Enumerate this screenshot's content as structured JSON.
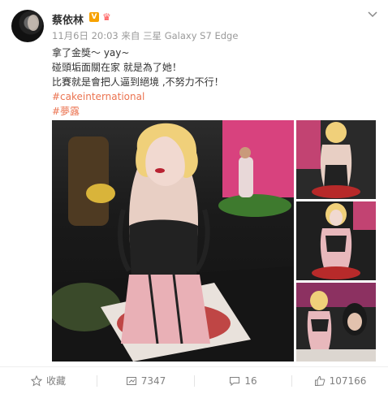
{
  "post": {
    "author": "蔡依林",
    "verified_badge": "V",
    "timestamp": "11月6日 20:03",
    "source_prefix": "来自",
    "device": "三星 Galaxy S7 Edge",
    "lines": [
      "拿了金獎～ yay~",
      "碰頭垢面關在家 就是為了她！",
      "比賽就是會把人逼到絕境 ,不努力不行！"
    ],
    "hashtags": [
      "#cakeinternational",
      "#夢露"
    ]
  },
  "actions": {
    "favorite_label": "收藏",
    "repost_count": "7347",
    "comment_count": "16",
    "like_count": "107166"
  },
  "icons": {
    "menu": "chevron-down-icon",
    "favorite": "star-icon",
    "repost": "repost-icon",
    "comment": "comment-icon",
    "like": "thumbs-up-icon"
  },
  "colors": {
    "hashtag": "#eb7350",
    "meta": "#9a9a9a",
    "badge": "#f7a200"
  }
}
